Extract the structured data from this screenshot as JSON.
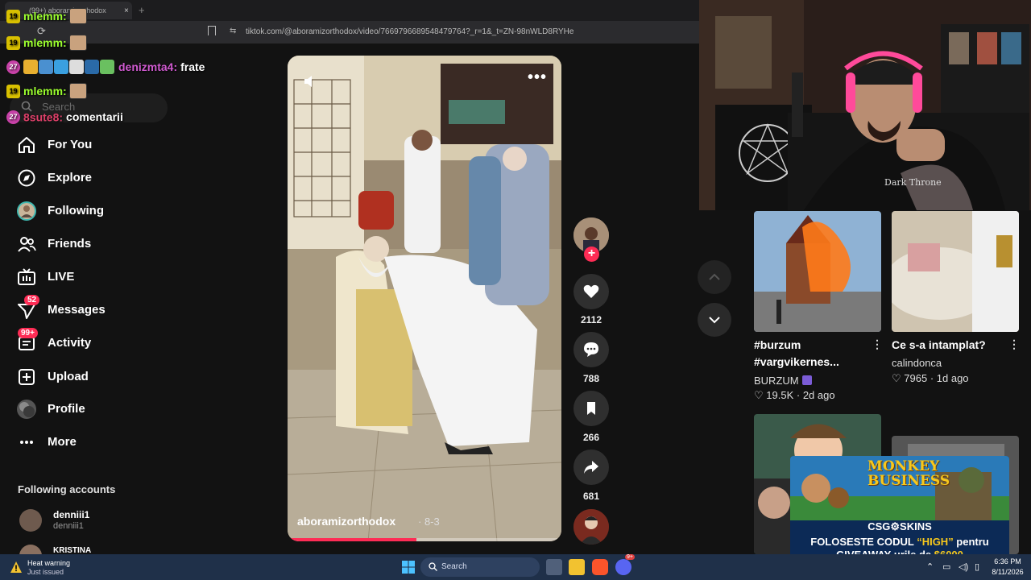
{
  "browser": {
    "tab_title": "(99+) aboramizorthodox",
    "tab_close": "×",
    "new_tab": "+",
    "url": "tiktok.com/@aboramizorthodox/video/7669796689548479764?_r=1&_t=ZN-98nWLD8RYHe"
  },
  "sidebar": {
    "search_placeholder": "Search",
    "nav": [
      {
        "label": "For You",
        "icon": "home-icon"
      },
      {
        "label": "Explore",
        "icon": "compass-icon"
      },
      {
        "label": "Following",
        "icon": "following-avatar-icon"
      },
      {
        "label": "Friends",
        "icon": "friends-icon"
      },
      {
        "label": "LIVE",
        "icon": "live-tv-icon"
      },
      {
        "label": "Messages",
        "icon": "messages-icon",
        "badge": "52"
      },
      {
        "label": "Activity",
        "icon": "activity-icon",
        "badge": "99+"
      },
      {
        "label": "Upload",
        "icon": "upload-icon"
      },
      {
        "label": "Profile",
        "icon": "profile-avatar-icon"
      },
      {
        "label": "More",
        "icon": "more-dots-icon"
      }
    ],
    "following_header": "Following accounts",
    "accounts": [
      {
        "name": "denniii1",
        "handle": "denniii1"
      },
      {
        "name": "KRISTINA",
        "handle": ""
      }
    ]
  },
  "video": {
    "author": "aboramizorthodox",
    "date": "· 8-3",
    "progress": 0.47,
    "more": "•••"
  },
  "actions": {
    "likes": "2112",
    "comments": "788",
    "saves": "266",
    "shares": "681",
    "follow": "+"
  },
  "suggested": [
    {
      "title": "#burzum #vargvikernes...",
      "author": "BURZUM",
      "likes": "19.5K",
      "age": "2d ago"
    },
    {
      "title": "Ce s-a intamplat?",
      "author": "calindonca",
      "likes": "7965",
      "age": "1d ago"
    }
  ],
  "sponsor": {
    "title_line1": "MONKEY",
    "title_line2": "BUSINESS",
    "brand": "CSG⚙SKINS",
    "line1_pre": "FOLOSESTE CODUL ",
    "line1_code": "“HIGH”",
    "line1_post": " pentru",
    "line2_pre": "GIVEAWAY-urile de ",
    "line2_amount": "$6000"
  },
  "chat": [
    {
      "badge": "19",
      "user": "mlemm:",
      "user_color": "#9cff2e",
      "msg": ""
    },
    {
      "badge": "19",
      "user": "mlemm:",
      "user_color": "#9cff2e",
      "msg": ""
    },
    {
      "badge": "27",
      "user": "denizmta4:",
      "user_color": "#d05ad0",
      "msg": "frate"
    },
    {
      "badge": "19",
      "user": "mlemm:",
      "user_color": "#9cff2e",
      "msg": ""
    },
    {
      "badge": "27",
      "user": "8sute8:",
      "user_color": "#e0406a",
      "msg": "comentarii"
    }
  ],
  "taskbar": {
    "warning_title": "Heat warning",
    "warning_sub": "Just issued",
    "search_placeholder": "Search",
    "discord_badge": "9+",
    "time": "6:36 PM",
    "date": "8/11/2026"
  },
  "colors": {
    "accent": "#fe2c55",
    "background": "#121212",
    "taskbar": "#1f3049",
    "sponsor_gold": "#f7c81c"
  }
}
